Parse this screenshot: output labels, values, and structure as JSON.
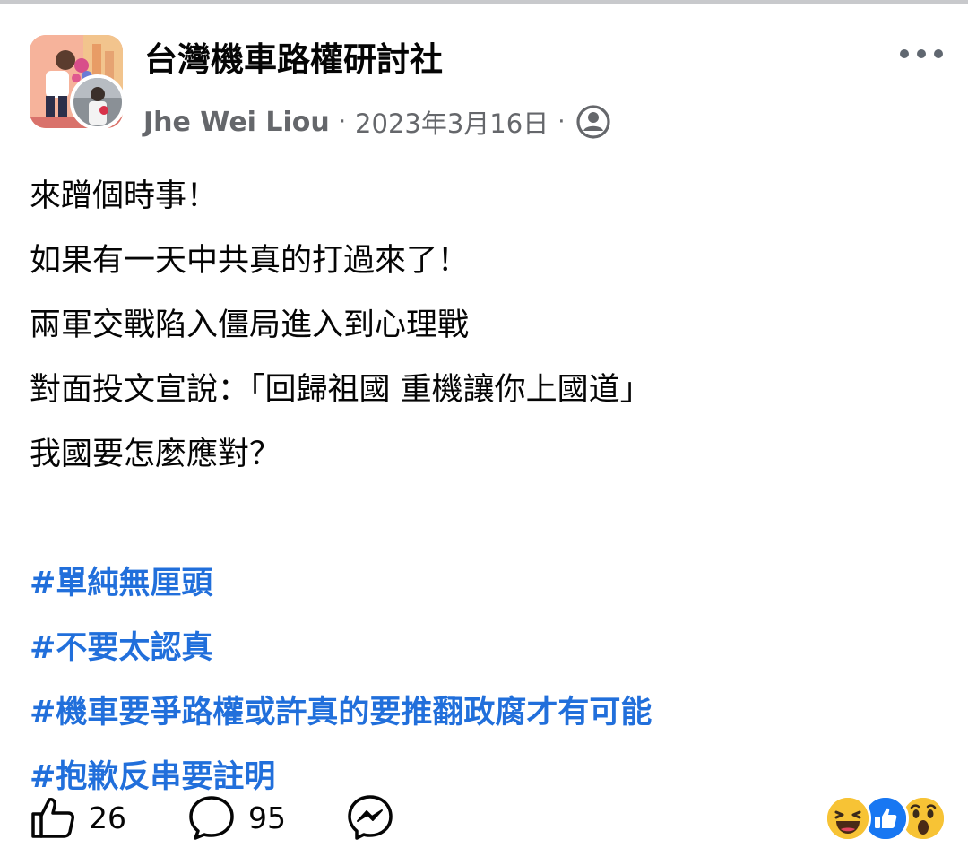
{
  "post": {
    "group_name": "台灣機車路權研討社",
    "author": "Jhe Wei Liou",
    "separator": "·",
    "date": "2023年3月16日",
    "privacy_icon": "friends-icon",
    "more_icon": "more-horizontal-icon",
    "lines": [
      "來蹭個時事！",
      "如果有一天中共真的打過來了！",
      "兩軍交戰陷入僵局進入到心理戰",
      "對面投文宣說：「回歸祖國 重機讓你上國道」",
      "我國要怎麼應對？"
    ],
    "hashtags": [
      "#單純無厘頭",
      "#不要太認真",
      "#機車要爭路權或許真的要推翻政腐才有可能",
      "#抱歉反串要註明"
    ],
    "like_count": "26",
    "comment_count": "95",
    "reactions": [
      "haha-icon",
      "like-icon",
      "wow-icon"
    ]
  },
  "colors": {
    "hashtag": "#216fdb",
    "meta_text": "#65676b",
    "like_blue": "#1877f2",
    "reaction_yellow": "#f7c335"
  }
}
